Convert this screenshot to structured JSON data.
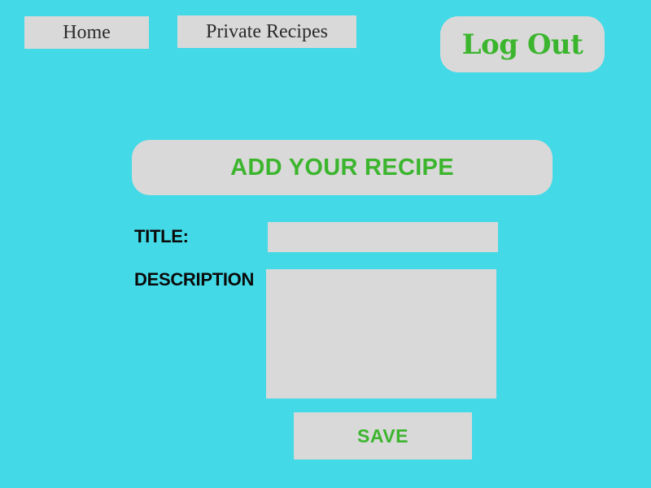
{
  "nav": {
    "home_label": "Home",
    "private_recipes_label": "Private Recipes",
    "logout_label": "Log Out"
  },
  "form": {
    "heading": "ADD YOUR RECIPE",
    "title_label": "TITLE:",
    "title_value": "",
    "description_label": "DESCRIPTION",
    "description_value": "",
    "save_label": "SAVE"
  },
  "colors": {
    "background": "#43d9e6",
    "panel": "#d9d9d9",
    "accent_green": "#3cb52e",
    "label_text": "#0a0a0a"
  }
}
